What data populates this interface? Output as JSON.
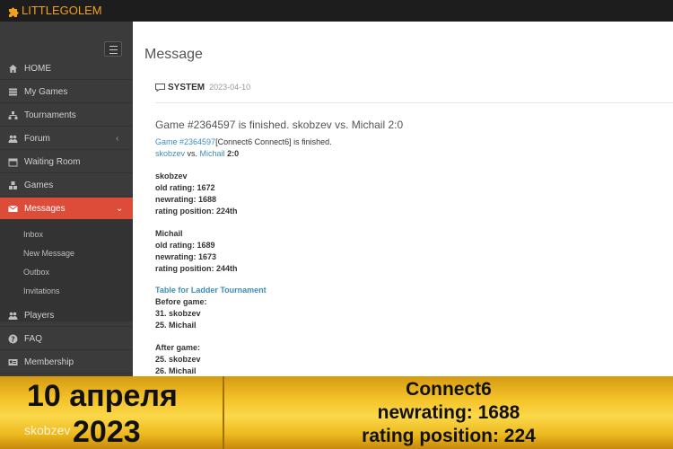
{
  "topbar": {
    "logo_text": "LITTLEGOLEM",
    "logo_icon": "puzzle-piece-icon"
  },
  "sidebar": {
    "items": [
      {
        "label": "HOME",
        "icon": "home-icon"
      },
      {
        "label": "My Games",
        "icon": "list-icon"
      },
      {
        "label": "Tournaments",
        "icon": "sitemap-icon"
      },
      {
        "label": "Forum",
        "icon": "users-icon"
      },
      {
        "label": "Waiting Room",
        "icon": "calendar-icon"
      },
      {
        "label": "Games",
        "icon": "cubes-icon"
      },
      {
        "label": "Messages",
        "icon": "envelope-icon",
        "active": true
      }
    ],
    "submenu": [
      "Inbox",
      "New Message",
      "Outbox",
      "Invitations"
    ],
    "items_bottom": [
      {
        "label": "Players",
        "icon": "users-icon"
      },
      {
        "label": "FAQ",
        "icon": "question-icon"
      },
      {
        "label": "Membership",
        "icon": "id-card-icon"
      }
    ],
    "chevron_left": "‹",
    "chevron_down": "⌄"
  },
  "main": {
    "page_title": "Message",
    "sender": "SYSTEM",
    "date": "2023-04-10",
    "subject": "Game #2364597 is finished. skobzev vs. Michail 2:0",
    "body": {
      "game_link": "Game #2364597",
      "game_rest": "[Connect6 Connect6] is finished.",
      "player1": "skobzev",
      "vs": " vs. ",
      "player2": "Michail",
      "score": "2:0",
      "p1_name": "skobzev",
      "p1_old": "old rating: 1672",
      "p1_new": "newrating: 1688",
      "p1_pos": "rating position: 224th",
      "p2_name": "Michail",
      "p2_old": "old rating: 1689",
      "p2_new": "newrating: 1673",
      "p2_pos": "rating position: 244th",
      "ladder_link": "Table for Ladder Tournament",
      "before": "Before game:",
      "before_1": "31. skobzev",
      "before_2": "25. Michail",
      "after": "After game:",
      "after_1": "25. skobzev",
      "after_2": "26. Michail"
    }
  },
  "banner": {
    "date_line1": "10 апреля",
    "date_line2": "2023",
    "user": "skobzev",
    "line1": "Connect6",
    "line2": "newrating: 1688",
    "line3": "rating position: 224"
  },
  "colors": {
    "active": "#dd4b39",
    "link": "#3c8dbc",
    "logo": "#f3a01c",
    "sidebar": "#3b3b3b"
  }
}
